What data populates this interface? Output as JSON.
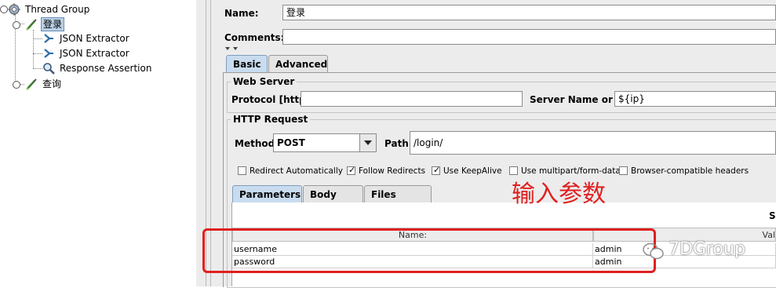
{
  "tree": {
    "thread_group": "Thread Group",
    "login": "登录",
    "json_extractor_1": "JSON Extractor",
    "json_extractor_2": "JSON Extractor",
    "response_assertion": "Response Assertion",
    "query": "查询"
  },
  "form": {
    "name_label": "Name:",
    "name_value": "登录",
    "comments_label": "Comments:",
    "comments_value": ""
  },
  "tabs": {
    "basic": "Basic",
    "advanced": "Advanced",
    "active": "Basic"
  },
  "web_server": {
    "title": "Web Server",
    "protocol_label": "Protocol [http]:",
    "protocol_value": "",
    "server_label": "Server Name or IP:",
    "server_value": "${ip}"
  },
  "http_request": {
    "title": "HTTP Request",
    "method_label": "Method:",
    "method_value": "POST",
    "path_label": "Path:",
    "path_value": "/login/"
  },
  "options": [
    {
      "label": "Redirect Automatically",
      "checked": false
    },
    {
      "label": "Follow Redirects",
      "checked": true
    },
    {
      "label": "Use KeepAlive",
      "checked": true
    },
    {
      "label": "Use multipart/form-data",
      "checked": false
    },
    {
      "label": "Browser-compatible headers",
      "checked": false
    }
  ],
  "sub_tabs": {
    "parameters": "Parameters",
    "body_data": "Body Data",
    "files_upload": "Files Upload",
    "active": "Parameters"
  },
  "table": {
    "top_header_fragment": "S",
    "columns": [
      "Name:",
      "Val"
    ],
    "rows": [
      {
        "name": "username",
        "value": "admin"
      },
      {
        "name": "password",
        "value": "admin"
      }
    ]
  },
  "annotation": {
    "text": "输入参数",
    "color": "#e02020"
  },
  "watermark": "7DGroup",
  "colors": {
    "selection": "#b8cfe5",
    "active_tab": "#c9dcef",
    "panel_bg": "#ececec"
  }
}
